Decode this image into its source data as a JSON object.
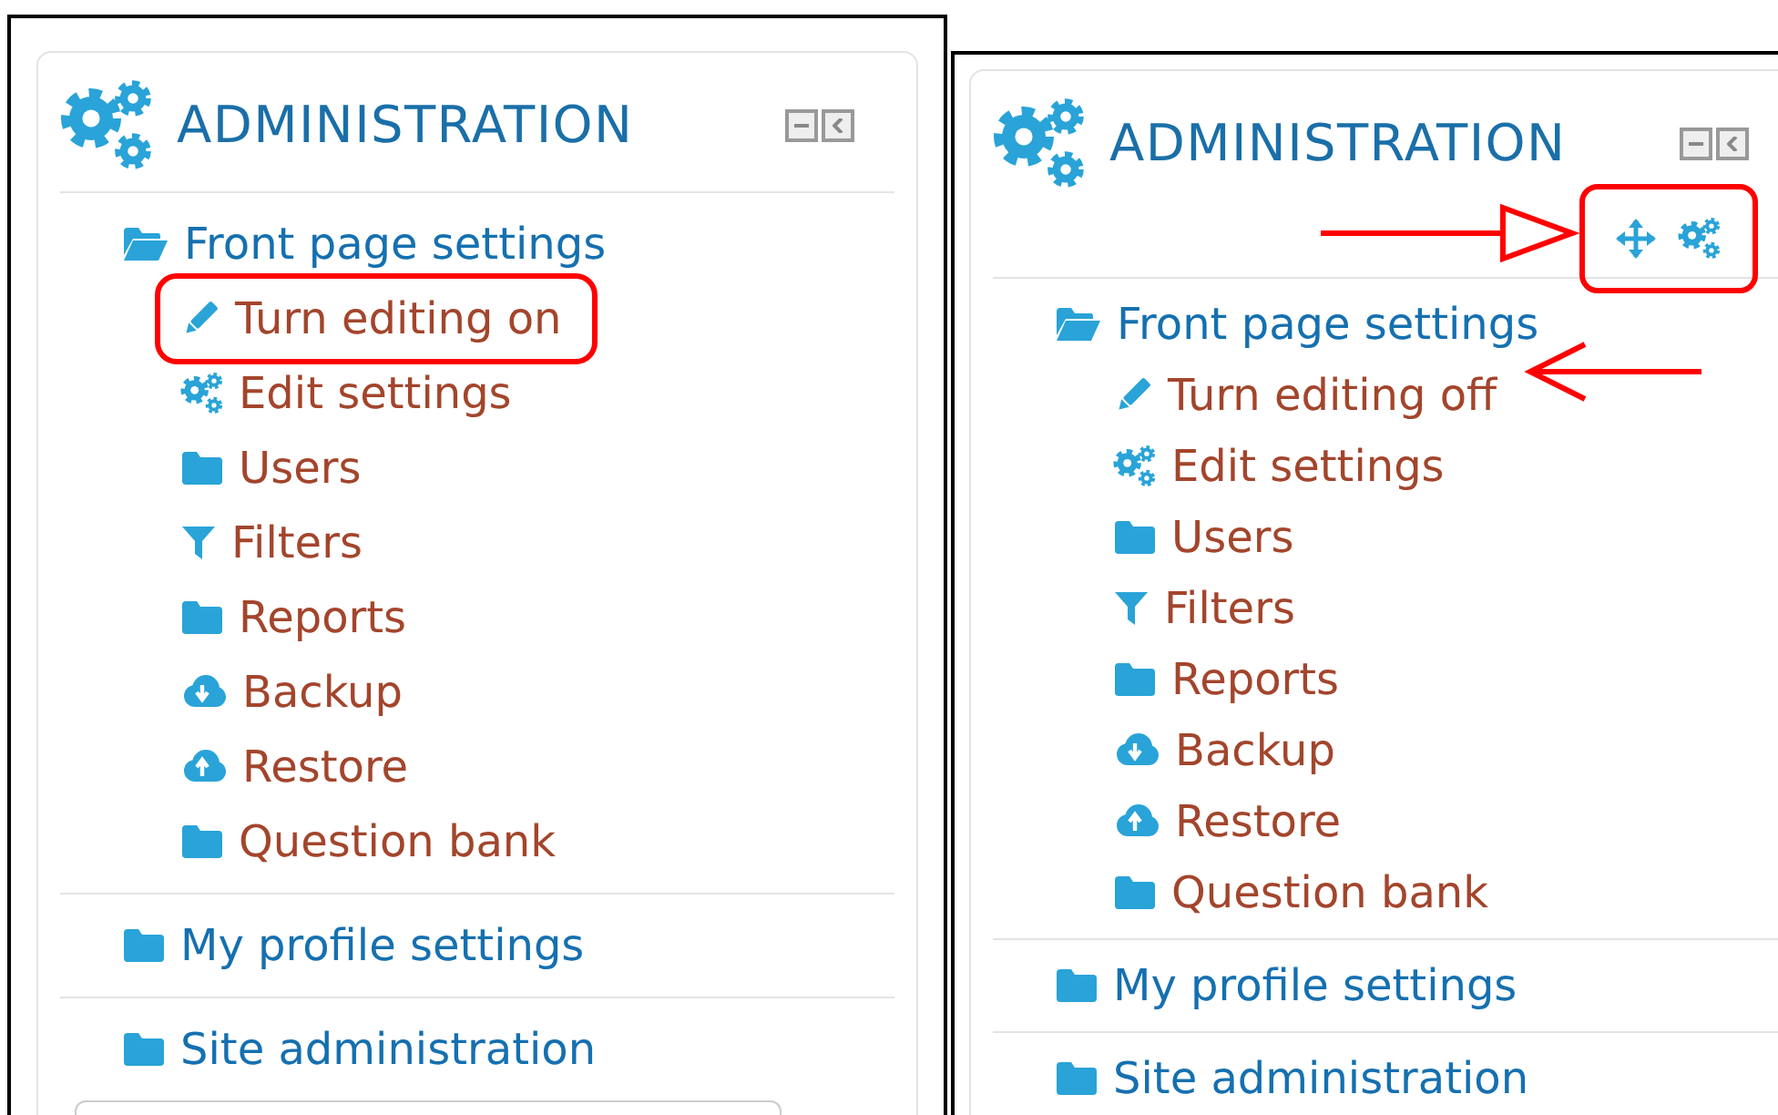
{
  "panels": [
    {
      "title": "ADMINISTRATION",
      "sections": [
        {
          "label": "Front page settings",
          "expanded": true,
          "children": [
            {
              "label": "Turn editing on",
              "kind": "pencil",
              "circled": true
            },
            {
              "label": "Edit settings",
              "kind": "gears"
            },
            {
              "label": "Users",
              "kind": "folder"
            },
            {
              "label": "Filters",
              "kind": "filter"
            },
            {
              "label": "Reports",
              "kind": "folder"
            },
            {
              "label": "Backup",
              "kind": "cloud-down"
            },
            {
              "label": "Restore",
              "kind": "cloud-up"
            },
            {
              "label": "Question bank",
              "kind": "folder"
            }
          ]
        },
        {
          "label": "My profile settings",
          "expanded": false
        },
        {
          "label": "Site administration",
          "expanded": false
        }
      ],
      "field_below": true
    },
    {
      "title": "ADMINISTRATION",
      "edit_controls": {
        "boxed": true
      },
      "sections": [
        {
          "label": "Front page settings",
          "expanded": true,
          "children": [
            {
              "label": "Turn editing off",
              "kind": "pencil",
              "pointed_at": true
            },
            {
              "label": "Edit settings",
              "kind": "gears"
            },
            {
              "label": "Users",
              "kind": "folder"
            },
            {
              "label": "Filters",
              "kind": "filter"
            },
            {
              "label": "Reports",
              "kind": "folder"
            },
            {
              "label": "Backup",
              "kind": "cloud-down"
            },
            {
              "label": "Restore",
              "kind": "cloud-up"
            },
            {
              "label": "Question bank",
              "kind": "folder"
            }
          ]
        },
        {
          "label": "My profile settings",
          "expanded": false
        },
        {
          "label": "Site administration",
          "expanded": false
        }
      ]
    }
  ]
}
